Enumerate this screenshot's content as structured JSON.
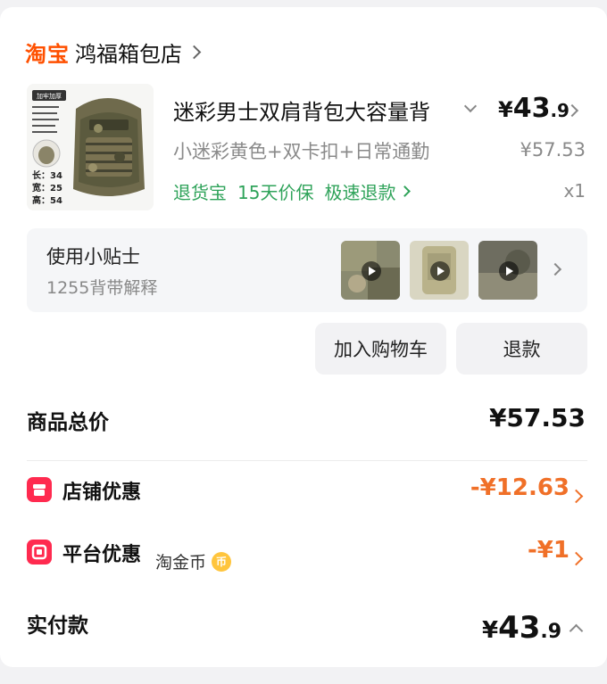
{
  "shop": {
    "brand": "淘宝",
    "name": "鸿福箱包店"
  },
  "product": {
    "title": "迷彩男士双肩背包大容量背",
    "price_currency": "¥",
    "price_int": "43",
    "price_dec": ".9",
    "variant": "小迷彩黄色+双卡扣+日常通勤",
    "original_price": "¥57.53",
    "services": [
      "退货宝",
      "15天价保",
      "极速退款"
    ],
    "quantity": "x1",
    "thumb": {
      "badge": "加牢加厚",
      "dims": [
        "长：34",
        "宽：25",
        "高：54"
      ]
    }
  },
  "tips": {
    "title": "使用小贴士",
    "subtitle": "1255背带解释",
    "videos": [
      "video-1",
      "video-2",
      "video-3"
    ]
  },
  "actions": {
    "add_to_cart": "加入购物车",
    "refund": "退款"
  },
  "summary": {
    "goods_total_label": "商品总价",
    "goods_total_value": "¥57.53",
    "shop_discount_label": "店铺优惠",
    "shop_discount_value": "-¥12.63",
    "platform_discount_label": "平台优惠",
    "platform_coin_label": "淘金币",
    "platform_coin_icon_text": "币",
    "platform_discount_value": "-¥1",
    "paid_label": "实付款",
    "paid_currency": "¥",
    "paid_int": "43",
    "paid_dec": ".9"
  },
  "colors": {
    "brand": "#ff5000",
    "service_green": "#2fa35a",
    "discount_orange": "#f07028",
    "discount_icon_red": "#ff2a4f"
  }
}
